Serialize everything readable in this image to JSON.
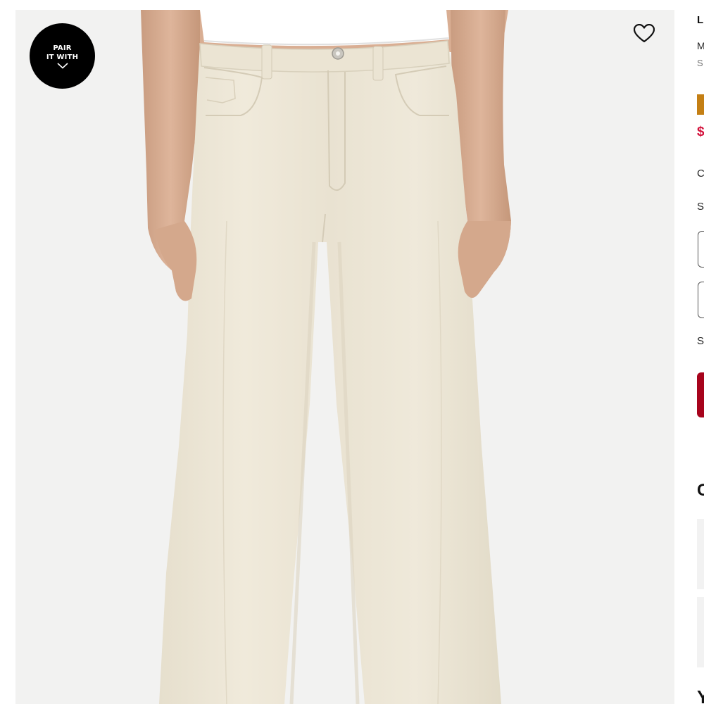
{
  "product_image": {
    "alt": "Cream colored straight-leg jeans on model"
  },
  "pair_badge": {
    "line1": "PAIR",
    "line2": "IT WITH",
    "icon": "chevron-down-icon"
  },
  "wishlist": {
    "icon": "heart-outline-icon"
  },
  "info": {
    "brand": "L",
    "title": "M",
    "subtitle": "S",
    "promo_color": "#c47f14",
    "price": "$",
    "price_color": "#d3103a",
    "color_label": "C",
    "size_label": "S",
    "shipping_label": "S",
    "cart_color": "#a7031c",
    "section_heading": "C",
    "bottom_heading": "Y"
  },
  "colors": {
    "background": "#f2f2f1",
    "pants": "#ede6d6",
    "badge": "#000000"
  }
}
